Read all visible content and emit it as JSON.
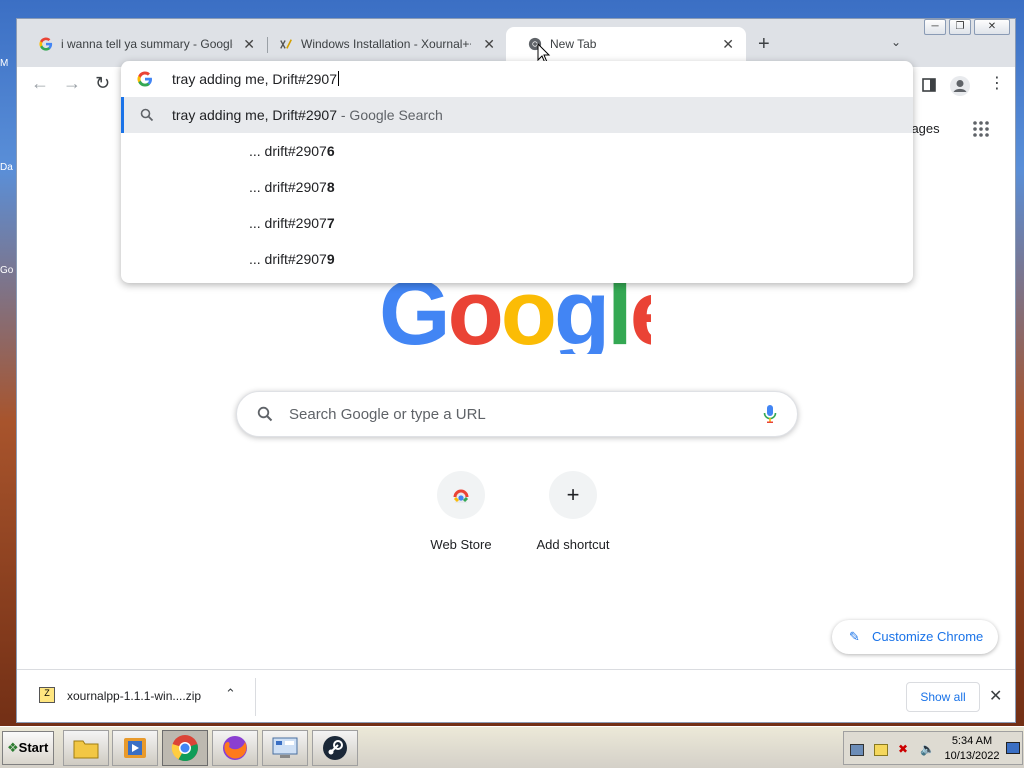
{
  "desktop": {
    "left_labels": [
      "M",
      "Da",
      "Go"
    ]
  },
  "browser": {
    "tabs": [
      {
        "title": "i wanna tell ya summary - Google Search",
        "active": false
      },
      {
        "title": "Windows Installation - Xournal++",
        "active": false
      },
      {
        "title": "New Tab",
        "active": true
      }
    ],
    "new_tab_symbol": "+",
    "omnibox": {
      "value": "tray adding me, Drift#2907",
      "suggestions": [
        {
          "text": "tray adding me, Drift#2907",
          "subtext": " - Google Search",
          "selected": true
        },
        {
          "prefix": "... drift#2907",
          "bold": "6"
        },
        {
          "prefix": "... drift#2907",
          "bold": "8"
        },
        {
          "prefix": "... drift#2907",
          "bold": "7"
        },
        {
          "prefix": "... drift#2907",
          "bold": "9"
        }
      ]
    }
  },
  "ntp": {
    "images_link": "Images",
    "search_placeholder": "Search Google or type a URL",
    "shortcuts": [
      {
        "label": "Web Store"
      },
      {
        "label": "Add shortcut",
        "icon": "+"
      }
    ],
    "customize_label": "Customize Chrome"
  },
  "downloads": {
    "file_name": "xournalpp-1.1.1-win....zip",
    "show_all": "Show all"
  },
  "taskbar": {
    "start_label": "Start",
    "clock_time": "5:34 AM",
    "clock_date": "10/13/2022"
  },
  "colors": {
    "google_blue": "#4285F4",
    "google_red": "#EA4335",
    "google_yellow": "#FBBC05",
    "google_green": "#34A853",
    "link_blue": "#1a73e8"
  }
}
